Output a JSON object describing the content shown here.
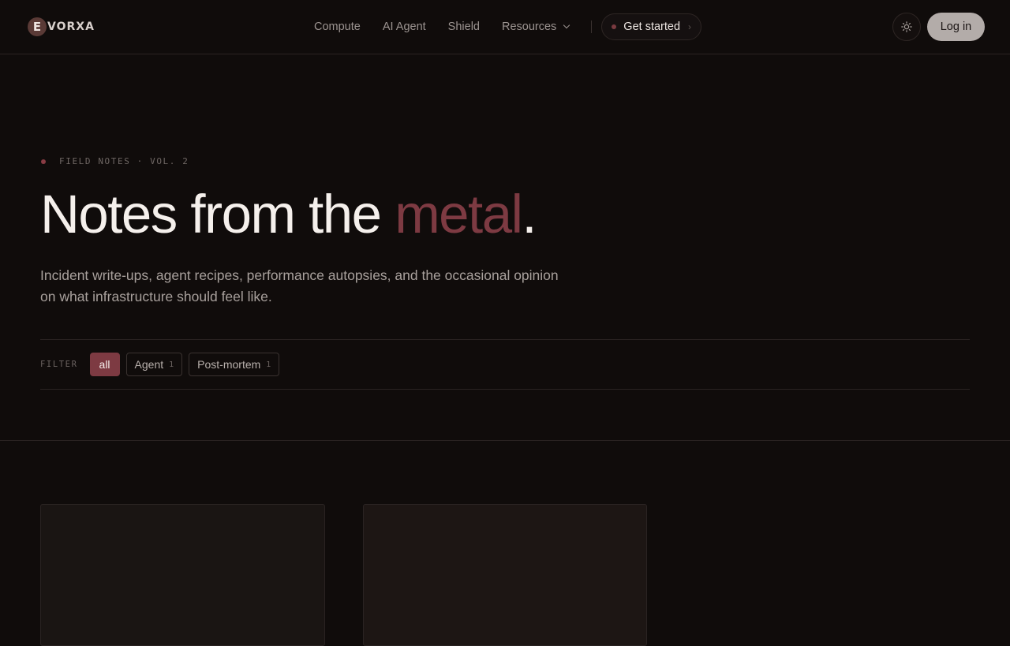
{
  "header": {
    "logo_letter": "E",
    "logo_text": "VORXA",
    "nav": [
      {
        "label": "Compute"
      },
      {
        "label": "AI Agent"
      },
      {
        "label": "Shield"
      },
      {
        "label": "Resources"
      }
    ],
    "cta_label": "Get started",
    "cta_arrow": "›",
    "theme_icon": "sun-icon",
    "login_label": "Log in"
  },
  "hero": {
    "eyebrow": "FIELD NOTES · VOL. 2",
    "title_pre": "Notes from the ",
    "title_accent": "metal",
    "title_post": ".",
    "description": "Incident write-ups, agent recipes, performance autopsies, and the occasional opinion on what infrastructure should feel like."
  },
  "filter": {
    "label": "FILTER",
    "chips": [
      {
        "label": "all",
        "count": null,
        "active": true
      },
      {
        "label": "Agent",
        "count": "1",
        "active": false
      },
      {
        "label": "Post-mortem",
        "count": "1",
        "active": false
      }
    ]
  },
  "colors": {
    "background": "#100c0b",
    "accent": "#7d3a42",
    "text": "#f5f0ec",
    "muted": "#a8a09c"
  }
}
